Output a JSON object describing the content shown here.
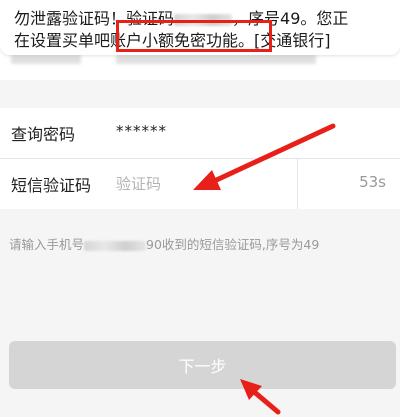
{
  "sms": {
    "line1_a": "勿泄露验证码！验证码",
    "line1_b": "，序号49。您正",
    "line2_a": "在设置买单吧",
    "line2_highlight": "账户小额免密功能。",
    "line2_b": "[交通银行]"
  },
  "form": {
    "query_password_label": "查询密码",
    "query_password_value": "******",
    "sms_code_label": "短信验证码",
    "sms_code_placeholder": "验证码",
    "countdown": "53s"
  },
  "hint": {
    "prefix": "请输入手机号",
    "suffix": "90收到的短信验证码,序号为49"
  },
  "next_button": "下一步",
  "colors": {
    "annotation_red": "#e8201a",
    "button_disabled": "#d5d5d5"
  }
}
